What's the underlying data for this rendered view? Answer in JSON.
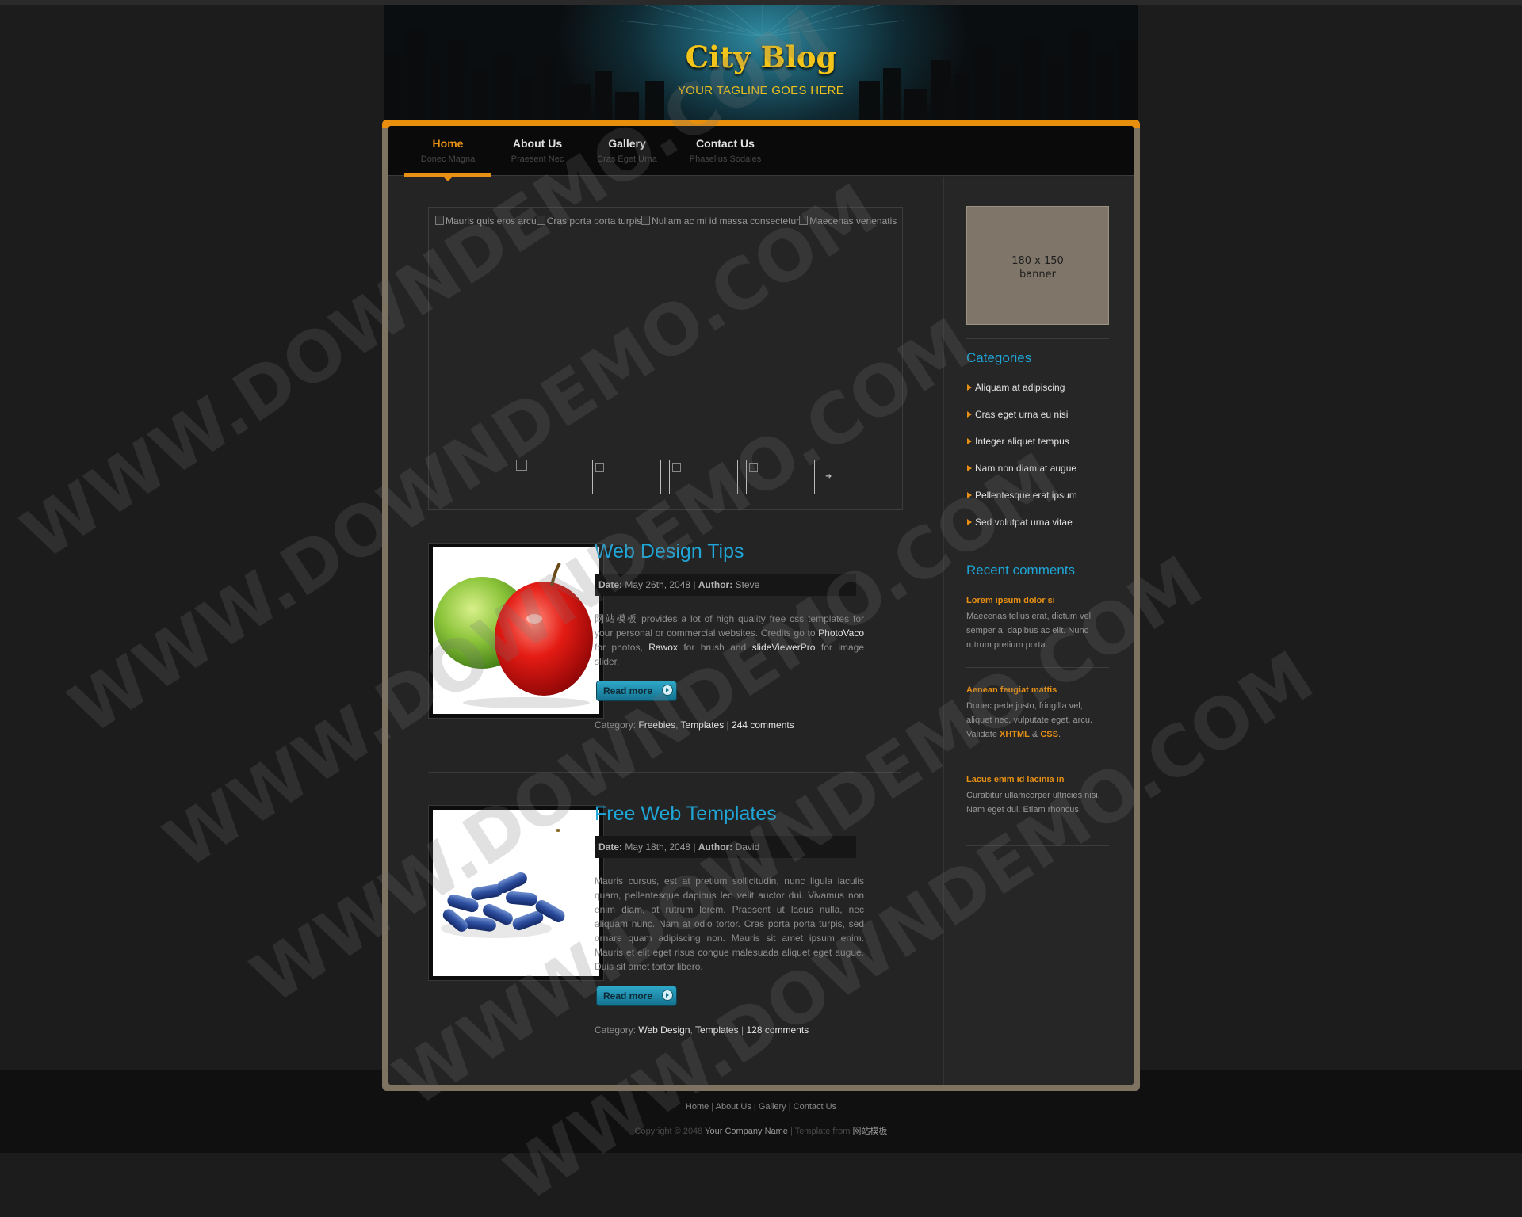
{
  "header": {
    "logo": "City Blog",
    "tagline": "YOUR TAGLINE GOES HERE"
  },
  "nav": [
    {
      "label": "Home",
      "sub": "Donec Magna"
    },
    {
      "label": "About Us",
      "sub": "Praesent Nec"
    },
    {
      "label": "Gallery",
      "sub": "Cras Eget Urna"
    },
    {
      "label": "Contact Us",
      "sub": "Phasellus Sodales"
    }
  ],
  "slider": {
    "alts": [
      "Mauris quis eros arcu",
      "Cras porta porta turpis",
      "Nullam ac mi id massa consectetur",
      "Maecenas venenatis"
    ]
  },
  "posts": [
    {
      "title": "Web Design Tips",
      "date_label": "Date:",
      "date": "May 26th, 2048",
      "author_label": "Author:",
      "author": "Steve",
      "body_pre": "网站模板 provides a lot of high quality free css templates for your personal or commercial websites. Credits go to ",
      "link1": "PhotoVaco",
      "body_mid1": " for photos, ",
      "link2": "Rawox",
      "body_mid2": " for brush and ",
      "link3": "slideViewerPro",
      "body_post": " for image slider.",
      "read_more": "Read more",
      "cat_label": "Category:",
      "cat1": "Freebies",
      "cat2": "Templates",
      "comments": "244 comments"
    },
    {
      "title": "Free Web Templates",
      "date_label": "Date:",
      "date": "May 18th, 2048",
      "author_label": "Author:",
      "author": "David",
      "body": "Mauris cursus, est at pretium sollicitudin, nunc ligula iaculis quam, pellentesque dapibus leo velit auctor dui. Vivamus non enim diam, at rutrum lorem. Praesent ut lacus nulla, nec aliquam nunc. Nam at odio tortor. Cras porta porta turpis, sed ornare quam adipiscing non. Mauris sit amet ipsum enim. Mauris et elit eget risus congue malesuada aliquet eget augue. Duis sit amet tortor libero.",
      "read_more": "Read more",
      "cat_label": "Category:",
      "cat1": "Web Design",
      "cat2": "Templates",
      "comments": "128 comments"
    }
  ],
  "sidebar": {
    "banner_line1": "180 x 150",
    "banner_line2": "banner",
    "categories_title": "Categories",
    "categories": [
      "Aliquam at adipiscing",
      "Cras eget urna eu nisi",
      "Integer aliquet tempus",
      "Nam non diam at augue",
      "Pellentesque erat ipsum",
      "Sed volutpat urna vitae"
    ],
    "recent_title": "Recent comments",
    "comments": [
      {
        "title": "Lorem ipsum dolor si",
        "body": "Maecenas tellus erat, dictum vel semper a, dapibus ac elit. Nunc rutrum pretium porta."
      },
      {
        "title": "Aenean feugiat mattis",
        "body": "Donec pede justo, fringilla vel, aliquet nec, vulputate eget, arcu. Validate ",
        "link1": "XHTML",
        "amp": " & ",
        "link2": "CSS",
        "end": "."
      },
      {
        "title": "Lacus enim id lacinia in",
        "body": "Curabitur ullamcorper ultricies nisi. Nam eget dui. Etiam rhoncus."
      }
    ]
  },
  "footer": {
    "links": [
      "Home",
      "About Us",
      "Gallery",
      "Contact Us"
    ],
    "sep": " | ",
    "copy_pre": "Copyright © 2048 ",
    "company": "Your Company Name",
    "copy_mid": " | Template from ",
    "source": "网站模板"
  },
  "watermark": "WWW.DOWNDEMO.COM",
  "colors": {
    "accent": "#e89013",
    "link_blue": "#1fa5d6",
    "logo_yellow": "#f3c419"
  }
}
